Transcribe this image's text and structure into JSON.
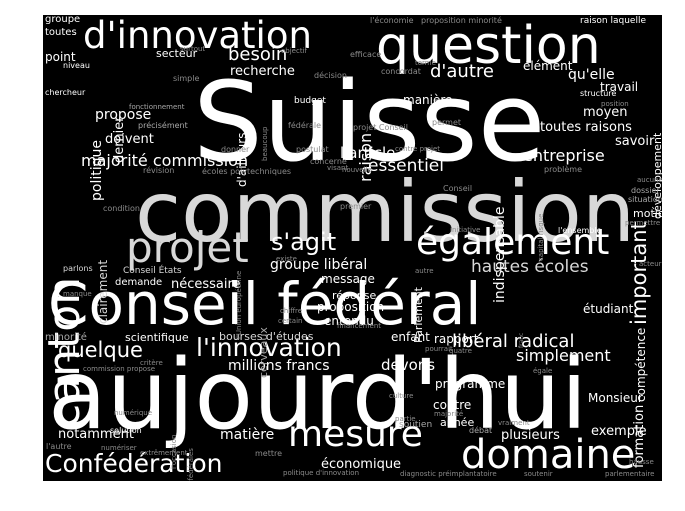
{
  "colors": {
    "background": "#000000",
    "frame": "#ffffff",
    "bright": "#ffffff",
    "mid": "#d8d8d8",
    "dim": "#a8a8a8",
    "faint": "#8a8a8a"
  },
  "words": {
    "suisse": "Suisse",
    "commission": "commission",
    "aujourdhui": "aujourd'hui",
    "conseil_federal": "Conseil fédéral",
    "question": "question",
    "d_innovation": "d'innovation",
    "canton": "canton",
    "projet": "projet",
    "egalement": "également",
    "mesure": "mesure",
    "domaine": "domaine",
    "confederation": "Confédération",
    "l_innovation": "l'innovation",
    "quelque": "quelque",
    "s_agit": "s'agit",
    "majorite_commission": "majorité commission",
    "important": "important",
    "entreprise": "entreprise",
    "liberal_radical": "libéral radical",
    "simplement": "simplement",
    "hautes_ecoles": "hautes écoles",
    "groupe_liberal": "groupe libéral",
    "besoin": "besoin",
    "d_autre": "d'autre",
    "raison": "raison",
    "essentiel": "essentiel",
    "l_article": "l'article",
    "indispensable": "indispensable",
    "politique": "politique",
    "propose": "propose",
    "recherche": "recherche",
    "d_ailleurs": "d'ailleurs",
    "millions_francs": "millions francs",
    "devons": "devons",
    "matiere": "matière",
    "notamment": "notamment",
    "plusieurs": "plusieurs",
    "exemple": "exemple",
    "economique": "économique",
    "formation": "formation",
    "competence": "compétence",
    "developpement": "développement",
    "qu_elle": "qu'elle",
    "moyen": "moyen",
    "toutes_raisons": "toutes raisons",
    "savoir": "savoir",
    "element": "élément",
    "travail": "travail",
    "maniere": "manière",
    "dernier": "dernier",
    "doivent": "doivent",
    "clairement": "clairement",
    "necessaire": "nécessaire",
    "message": "message",
    "reponse": "réponse",
    "proposition": "proposition",
    "entendu": "entendu",
    "rapport": "rapport",
    "enfant": "enfant",
    "etudiant": "étudiant",
    "motion": "motion",
    "parlement": "Parlement",
    "contre": "contre",
    "annee": "année",
    "programme": "programme",
    "monsieur": "Monsieur",
    "point": "point",
    "groupe": "groupe",
    "toutes": "toutes",
    "secteur": "secteur",
    "scientifique": "scientifique",
    "bourses_d_etudes": "bourses d'études",
    "cerveaux": "cerveaux",
    "demande": "demande",
    "minorite": "minorité",
    "budget": "budget",
    "soutien": "soutien",
    "debat": "débat",
    "situation": "situation",
    "dossier": "dossier",
    "conseil_etats": "Conseil États",
    "parlons": "parlons",
    "chercheur": "chercheur",
    "fonctionnement": "fonctionnement",
    "precisement": "précisément",
    "niveau": "niveau",
    "surtout": "surtout",
    "objectif": "objectif",
    "efficace": "efficace",
    "concordat": "concordat",
    "decision": "décision",
    "terme": "terme",
    "l_economie": "l'économie",
    "proposition_minorite": "proposition minorité",
    "raison_laquelle": "raison laquelle",
    "simple": "simple",
    "beaucoup": "beaucoup",
    "federale": "fédérale",
    "projet_conseil": "projet Conseil",
    "permet": "permet",
    "contre_projet": "contre projet",
    "position": "position",
    "structure": "structure",
    "probleme": "problème",
    "postulat": "postulat",
    "concerne": "concerne",
    "nouvelle": "nouvelle",
    "visant": "visant",
    "donner": "donner",
    "revision": "révision",
    "ecoles_polytechniques": "écoles polytechniques",
    "condition": "condition",
    "premier": "premier",
    "conseil": "Conseil",
    "capital_risque": "capital risque",
    "initiative": "initiative",
    "l_ensemble": "l'ensemble",
    "aucune": "aucune",
    "acteur": "acteur",
    "permettre": "permettre",
    "l_union_europeenne": "l'Union européenne",
    "existe": "existe",
    "autre": "autre",
    "manque": "manque",
    "chiffre": "chiffre",
    "certain": "certain",
    "financement": "financement",
    "franc": "franc",
    "pourrait": "pourrait",
    "quatre": "quatre",
    "egale": "égale",
    "critere": "critère",
    "commission_propose": "commission propose",
    "numerique": "numérique",
    "solution": "solution",
    "l_occasion": "l'occasion",
    "politiques_federales": "politiques fédérales",
    "culture": "culture",
    "partie": "partie",
    "majorite": "majorité",
    "vraiment": "vraiment",
    "l_autre": "l'autre",
    "numeriser": "numériser",
    "extremement": "extrêmement",
    "mettre": "mettre",
    "politique_d_innovation": "politique d'innovation",
    "diagnostic_preimplantatoire": "diagnostic préimplantatoire",
    "soutenir": "soutenir",
    "parlementaire": "parlementaire",
    "hausse": "hausse"
  }
}
